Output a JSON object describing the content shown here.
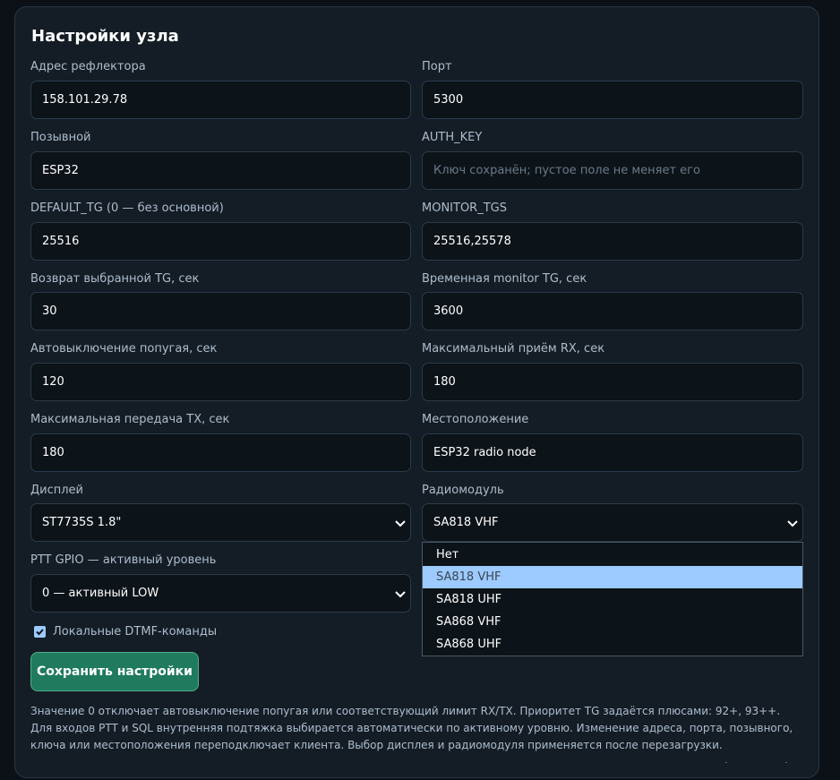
{
  "title": "Настройки узла",
  "fields": {
    "reflector_address": {
      "label": "Адрес рефлектора",
      "value": "158.101.29.78"
    },
    "port": {
      "label": "Порт",
      "value": "5300"
    },
    "callsign": {
      "label": "Позывной",
      "value": "ESP32"
    },
    "auth_key": {
      "label": "AUTH_KEY",
      "value": "",
      "placeholder": "Ключ сохранён; пустое поле не меняет его"
    },
    "default_tg": {
      "label": "DEFAULT_TG (0 — без основной)",
      "value": "25516"
    },
    "monitor_tgs": {
      "label": "MONITOR_TGS",
      "value": "25516,25578"
    },
    "tg_return": {
      "label": "Возврат выбранной TG, сек",
      "value": "30"
    },
    "temp_monitor_tg": {
      "label": "Временная monitor TG, сек",
      "value": "3600"
    },
    "parrot_off": {
      "label": "Автовыключение попугая, сек",
      "value": "120"
    },
    "max_rx": {
      "label": "Максимальный приём RX, сек",
      "value": "180"
    },
    "max_tx": {
      "label": "Максимальная передача TX, сек",
      "value": "180"
    },
    "location": {
      "label": "Местоположение",
      "value": "ESP32 radio node"
    },
    "display": {
      "label": "Дисплей",
      "value": "ST7735S 1.8\""
    },
    "radio_module": {
      "label": "Радиомодуль",
      "value": "SA818 VHF",
      "options": [
        "Нет",
        "SA818 VHF",
        "SA818 UHF",
        "SA868 VHF",
        "SA868 UHF"
      ],
      "highlighted": "SA818 VHF"
    },
    "ptt_gpio": {
      "label": "PTT GPIO — активный уровень",
      "value": "0 — активный LOW"
    }
  },
  "local_dtmf": {
    "label": "Локальные DTMF-команды",
    "checked": true
  },
  "save_label": "Сохранить настройки",
  "note": "Значение 0 отключает автовыключение попугая или соответствующий лимит RX/TX. Приоритет TG задаётся плюсами: 92+, 93++. Для входов PTT и SQL внутренняя подтяжка выбирается автоматически по активному уровню. Изменение адреса, порта, позывного, ключа или местоположения переподключает клиента. Выбор дисплея и радиомодуля применяется после перезагрузки.",
  "colors": {
    "background": "#0b1117",
    "card": "#141d26",
    "input_bg": "#0c1319",
    "accent_button": "#1f7a5e",
    "highlight": "#9dcbff"
  }
}
